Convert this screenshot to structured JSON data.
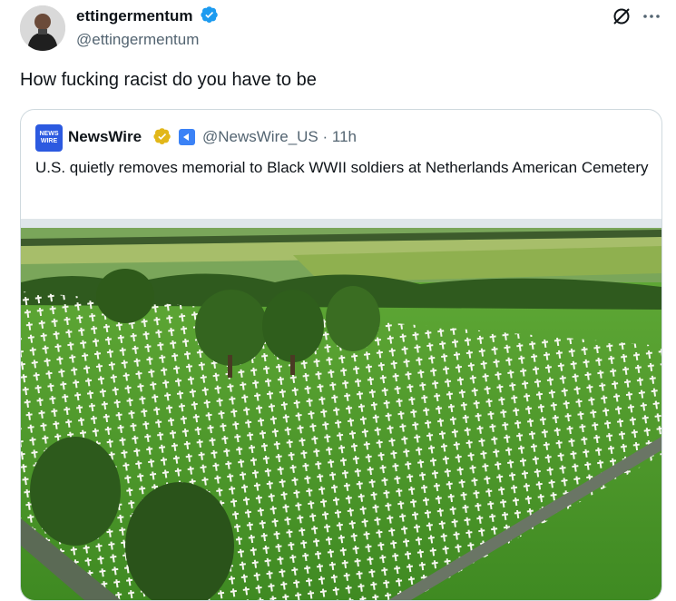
{
  "tweet": {
    "author_name": "ettingermentum",
    "handle": "@ettingermentum",
    "text": "How fucking racist do you have to be"
  },
  "quote": {
    "logo_text": "NEWS WIRE",
    "author_name": "NewsWire",
    "handle_time": "@NewsWire_US · 11h",
    "text": "U.S. quietly removes memorial to Black WWII soldiers at Netherlands American Cemetery"
  },
  "colors": {
    "verified_blue": "#1d9bf0",
    "verified_gold": "#e2b719",
    "text_primary": "#0f1419",
    "text_secondary": "#536471",
    "border": "#cfd9de",
    "grass": "#4f9a2a"
  },
  "icons": [
    "verified-badge-icon",
    "grok-icon",
    "more-icon",
    "gold-verified-icon",
    "affiliate-badge-icon"
  ]
}
